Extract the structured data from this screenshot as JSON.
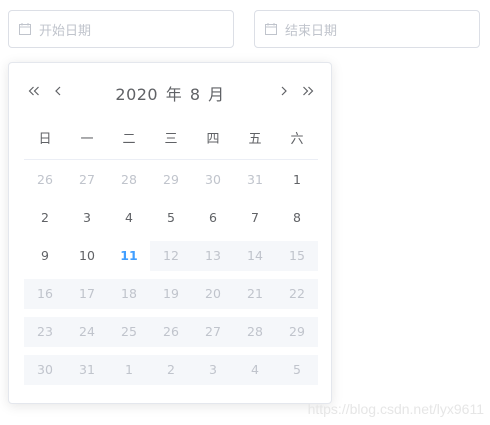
{
  "start_field": {
    "placeholder": "开始日期",
    "icon": "calendar-icon"
  },
  "end_field": {
    "placeholder": "结束日期",
    "icon": "calendar-icon"
  },
  "picker": {
    "year": "2020",
    "year_unit": "年",
    "month": "8",
    "month_unit": "月",
    "weekdays": [
      "日",
      "一",
      "二",
      "三",
      "四",
      "五",
      "六"
    ],
    "weeks": [
      [
        {
          "d": "26",
          "s": "other"
        },
        {
          "d": "27",
          "s": "other"
        },
        {
          "d": "28",
          "s": "other"
        },
        {
          "d": "29",
          "s": "other"
        },
        {
          "d": "30",
          "s": "other"
        },
        {
          "d": "31",
          "s": "other"
        },
        {
          "d": "1",
          "s": "normal"
        }
      ],
      [
        {
          "d": "2",
          "s": "normal"
        },
        {
          "d": "3",
          "s": "normal"
        },
        {
          "d": "4",
          "s": "normal"
        },
        {
          "d": "5",
          "s": "normal"
        },
        {
          "d": "6",
          "s": "normal"
        },
        {
          "d": "7",
          "s": "normal"
        },
        {
          "d": "8",
          "s": "normal"
        }
      ],
      [
        {
          "d": "9",
          "s": "normal"
        },
        {
          "d": "10",
          "s": "normal"
        },
        {
          "d": "11",
          "s": "today"
        },
        {
          "d": "12",
          "s": "disabled"
        },
        {
          "d": "13",
          "s": "disabled"
        },
        {
          "d": "14",
          "s": "disabled"
        },
        {
          "d": "15",
          "s": "disabled"
        }
      ],
      [
        {
          "d": "16",
          "s": "disabled"
        },
        {
          "d": "17",
          "s": "disabled"
        },
        {
          "d": "18",
          "s": "disabled"
        },
        {
          "d": "19",
          "s": "disabled"
        },
        {
          "d": "20",
          "s": "disabled"
        },
        {
          "d": "21",
          "s": "disabled"
        },
        {
          "d": "22",
          "s": "disabled"
        }
      ],
      [
        {
          "d": "23",
          "s": "disabled"
        },
        {
          "d": "24",
          "s": "disabled"
        },
        {
          "d": "25",
          "s": "disabled"
        },
        {
          "d": "26",
          "s": "disabled"
        },
        {
          "d": "27",
          "s": "disabled"
        },
        {
          "d": "28",
          "s": "disabled"
        },
        {
          "d": "29",
          "s": "disabled"
        }
      ],
      [
        {
          "d": "30",
          "s": "disabled"
        },
        {
          "d": "31",
          "s": "disabled"
        },
        {
          "d": "1",
          "s": "disabled"
        },
        {
          "d": "2",
          "s": "disabled"
        },
        {
          "d": "3",
          "s": "disabled"
        },
        {
          "d": "4",
          "s": "disabled"
        },
        {
          "d": "5",
          "s": "disabled"
        }
      ]
    ]
  },
  "colors": {
    "accent": "#409eff",
    "text": "#606266",
    "muted": "#c0c4cc",
    "disabled_bg": "#f5f7fa",
    "border": "#dcdfe6"
  },
  "watermark": "https://blog.csdn.net/lyx9611"
}
